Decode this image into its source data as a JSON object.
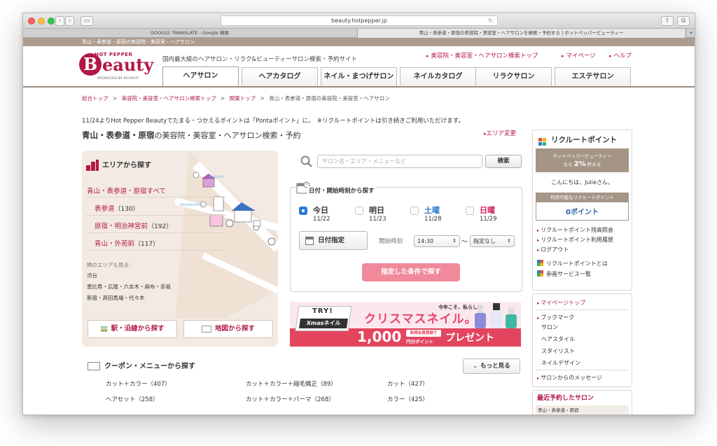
{
  "browser": {
    "url": "beauty.hotpepper.jp",
    "tabs": [
      {
        "label": "GOOGLE TRANSLATE - Google 検索"
      },
      {
        "label": "青山・表参道・原宿の美容院・美容室・ヘアサロンを検索・予約する | ホットペッパービューティー"
      }
    ]
  },
  "site": {
    "top_strip": "青山・表参道・原宿の美容院・美容室・ヘアサロン",
    "logo_top": "HOT PEPPER",
    "logo_main": "eauty",
    "logo_initial": "B",
    "logo_sub": "PRODUCED BY RECRUIT",
    "tagline": "国内最大級のヘアサロン・リラク&ビューティーサロン検索・予約サイト",
    "top_links": [
      "美容院・美容室・ヘアサロン検索トップ",
      "マイページ",
      "ヘルプ"
    ],
    "nav_tabs": [
      "ヘアサロン",
      "ヘアカタログ",
      "ネイル・まつげサロン",
      "ネイルカタログ",
      "リラクサロン",
      "エステサロン"
    ]
  },
  "breadcrumb": [
    "総合トップ",
    "美容院・美容室・ヘアサロン検索トップ",
    "関東トップ",
    "青山・表参道・原宿の美容院・美容室・ヘアサロン"
  ],
  "notice": "11/24よりHot Pepper Beautyでたまる・つかえるポイントは「Pontaポイント」に。　※リクルートポイントは引き続きご利用いただけます。",
  "page_title": {
    "strong": "青山・表参道・原宿",
    "rest": "の美容院・美容室・ヘアサロン検索・予約"
  },
  "area_change": "エリア変更",
  "area": {
    "heading": "エリアから探す",
    "all": "青山・表参道・原宿すべて",
    "items": [
      {
        "name": "表参道",
        "count": "（130）"
      },
      {
        "name": "原宿・明治神宮前",
        "count": "（192）"
      },
      {
        "name": "青山・外苑前",
        "count": "（117）"
      }
    ],
    "nearby_label": "隣のエリアも見る：",
    "nearby": [
      "渋谷",
      "恵比寿・広尾・六本木・麻布・赤坂",
      "新宿・高田馬場・代々木"
    ],
    "map_labels": [
      "HARAJUKU",
      "MEIJIJINGUMAE"
    ],
    "station_btn": "駅・沿線から探す",
    "map_btn": "地図から探す"
  },
  "search": {
    "placeholder": "サロン名・エリア・メニューなど",
    "button": "検索"
  },
  "date": {
    "heading": "日付・開始時刻から探す",
    "days": [
      {
        "name": "今日",
        "date": "11/22",
        "selected": true
      },
      {
        "name": "明日",
        "date": "11/23",
        "selected": false
      },
      {
        "name": "土曜",
        "date": "11/28",
        "selected": false
      },
      {
        "name": "日曜",
        "date": "11/29",
        "selected": false
      }
    ],
    "date_btn": "日付指定",
    "start_label": "開始時刻",
    "start_value": "14:30",
    "tilde": "～",
    "end_value": "指定なし",
    "go_btn": "指定した条件で探す"
  },
  "banner": {
    "try": "TRY!",
    "xmas": "Xmasネイル",
    "title": "クリスマスネイル。",
    "small": "今年こそ、私らしい",
    "amount": "1,000",
    "unit": "円分ポイント",
    "new_member": "新規会員登録で",
    "present": "プレゼント"
  },
  "coupon": {
    "heading": "クーポン・メニューから探す",
    "more": "もっと見る",
    "items": [
      "カット＋カラー（407）",
      "カット＋カラー＋縮毛矯正（89）",
      "カット（427）",
      "ヘアセット（258）",
      "カット＋カラー＋パーマ（268）",
      "カラー（425）"
    ]
  },
  "sidebar": {
    "rp_title": "リクルートポイント",
    "rp_rate_l1": "ホットペッパービューティー",
    "rp_rate_pre": "なら",
    "rp_rate_pct": "2%",
    "rp_rate_post": "貯まる",
    "greeting": "こんにちは、Julieさん。",
    "available_label": "利用可能なリクルートポイント",
    "points": "0ポイント",
    "links1": [
      "リクルートポイント残高照会",
      "リクルートポイント利用履歴",
      "ログアウト"
    ],
    "links2": [
      "リクルートポイントとは",
      "参画サービス一覧"
    ],
    "mypage": "マイページトップ",
    "bookmark": "ブックマーク",
    "bookmark_items": [
      "サロン",
      "ヘアスタイル",
      "スタイリスト",
      "ネイルデザイン"
    ],
    "messages": "サロンからのメッセージ",
    "recent_title": "最近予約したサロン",
    "recent_area": "青山・表参道・原宿"
  },
  "colors": {
    "brand": "#b21946",
    "strip": "#ae9c8f",
    "go_button": "#f08a9a",
    "selected": "#2d7bd0"
  }
}
